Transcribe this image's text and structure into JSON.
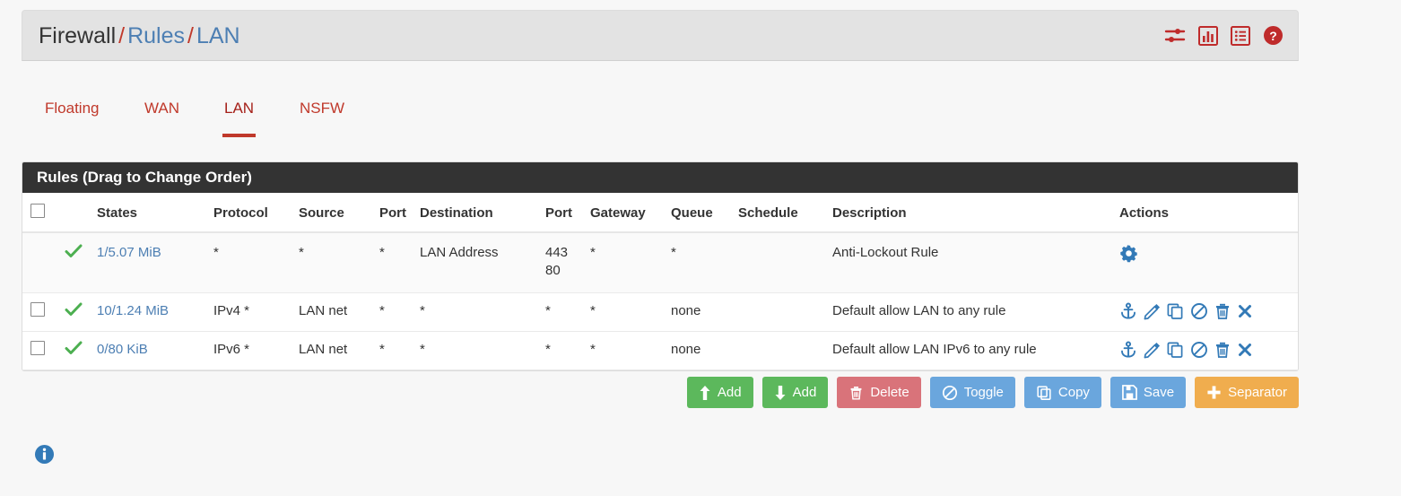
{
  "header": {
    "breadcrumb": [
      {
        "text": "Firewall",
        "type": "plain"
      },
      {
        "text": "/",
        "type": "sep"
      },
      {
        "text": "Rules",
        "type": "link"
      },
      {
        "text": "/",
        "type": "sep"
      },
      {
        "text": "LAN",
        "type": "link"
      }
    ],
    "icons": [
      {
        "name": "sliders-icon",
        "label": "Advanced filter"
      },
      {
        "name": "bar-chart-icon",
        "label": "Statistics"
      },
      {
        "name": "list-icon",
        "label": "Rule list"
      },
      {
        "name": "help-icon",
        "label": "Help"
      }
    ],
    "icon_color": "#bf2b2b"
  },
  "tabs": [
    {
      "label": "Floating",
      "active": false
    },
    {
      "label": "WAN",
      "active": false
    },
    {
      "label": "LAN",
      "active": true
    },
    {
      "label": "NSFW",
      "active": false
    }
  ],
  "panel": {
    "title": "Rules (Drag to Change Order)",
    "columns": [
      "States",
      "Protocol",
      "Source",
      "Port",
      "Destination",
      "Port",
      "Gateway",
      "Queue",
      "Schedule",
      "Description",
      "Actions"
    ],
    "rows": [
      {
        "has_checkbox": false,
        "status": "pass",
        "states": "1/5.07 MiB",
        "protocol": "*",
        "source": "*",
        "port_src": "*",
        "destination": "LAN Address",
        "port_dst": [
          "443",
          "80"
        ],
        "gateway": "*",
        "queue": "*",
        "schedule": "",
        "description": "Anti-Lockout Rule",
        "actions": [
          "gear-icon"
        ]
      },
      {
        "has_checkbox": true,
        "status": "pass",
        "states": "10/1.24 MiB",
        "protocol": "IPv4 *",
        "source": "LAN net",
        "port_src": "*",
        "destination": "*",
        "port_dst": [
          "*"
        ],
        "gateway": "*",
        "queue": "none",
        "schedule": "",
        "description": "Default allow LAN to any rule",
        "actions": [
          "anchor-icon",
          "pencil-icon",
          "copy-icon",
          "ban-icon",
          "trash-icon",
          "close-icon"
        ]
      },
      {
        "has_checkbox": true,
        "status": "pass",
        "states": "0/80 KiB",
        "protocol": "IPv6 *",
        "source": "LAN net",
        "port_src": "*",
        "destination": "*",
        "port_dst": [
          "*"
        ],
        "gateway": "*",
        "queue": "none",
        "schedule": "",
        "description": "Default allow LAN IPv6 to any rule",
        "actions": [
          "anchor-icon",
          "pencil-icon",
          "copy-icon",
          "ban-icon",
          "trash-icon",
          "close-icon"
        ]
      }
    ]
  },
  "buttons": [
    {
      "label": "Add",
      "icon": "arrow-up-icon",
      "style": "success"
    },
    {
      "label": "Add",
      "icon": "arrow-down-icon",
      "style": "success"
    },
    {
      "label": "Delete",
      "icon": "trash-icon",
      "style": "danger"
    },
    {
      "label": "Toggle",
      "icon": "ban-icon",
      "style": "info"
    },
    {
      "label": "Copy",
      "icon": "copy-icon",
      "style": "info"
    },
    {
      "label": "Save",
      "icon": "save-icon",
      "style": "info"
    },
    {
      "label": "Separator",
      "icon": "plus-icon",
      "style": "warning"
    }
  ],
  "footer": {
    "info_icon": "info-circle-icon",
    "info_color": "#337ab7"
  },
  "colors": {
    "link": "#4d7fb3",
    "tab_red": "#c0392b",
    "panel_header_bg": "#333333",
    "pass_green": "#4caf50",
    "action_blue": "#337ab7"
  }
}
